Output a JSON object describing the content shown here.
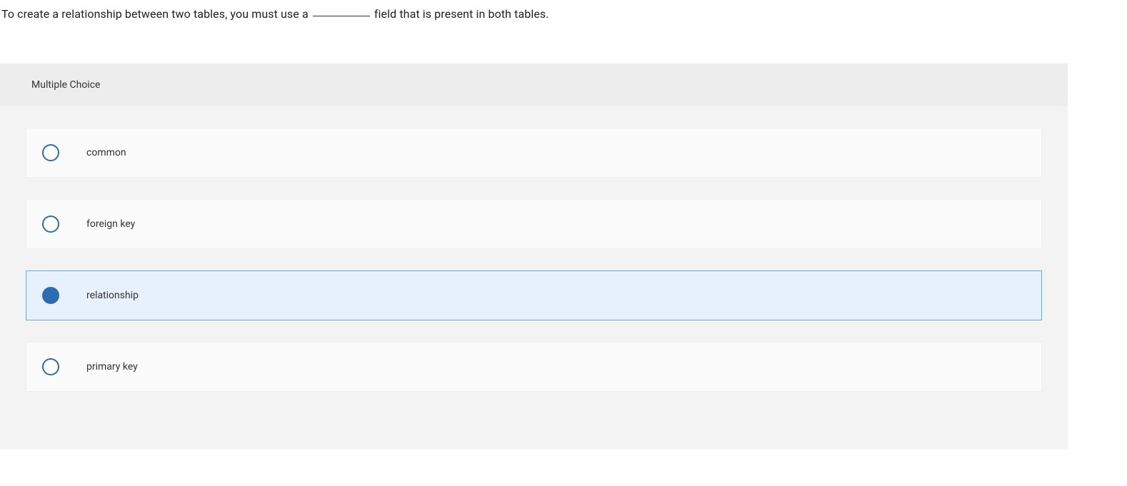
{
  "question": {
    "part1": "To create a relationship between two tables, you must use a ",
    "part2": " field that is present in both tables."
  },
  "panel": {
    "header": "Multiple Choice"
  },
  "options": [
    {
      "label": "common",
      "selected": false
    },
    {
      "label": "foreign key",
      "selected": false
    },
    {
      "label": "relationship",
      "selected": true
    },
    {
      "label": "primary key",
      "selected": false
    }
  ]
}
